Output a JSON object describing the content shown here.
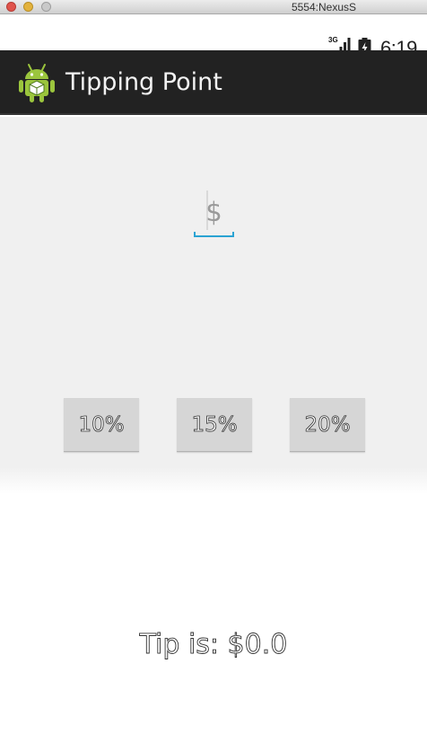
{
  "window": {
    "title": "5554:NexusS"
  },
  "status_bar": {
    "network": "3G",
    "signal_icon": "cell-signal-icon",
    "battery_icon": "battery-charging-icon",
    "time": "6:19"
  },
  "action_bar": {
    "app_icon": "android-robot-icon",
    "title": "Tipping Point"
  },
  "amount_input": {
    "placeholder": "$",
    "value": ""
  },
  "tip_buttons": [
    {
      "label": "10%"
    },
    {
      "label": "15%"
    },
    {
      "label": "20%"
    }
  ],
  "result": {
    "text": "Tip is: $0.0"
  },
  "colors": {
    "action_bar": "#222222",
    "content_bg": "#f0f0f0",
    "input_accent": "#2aa3d3",
    "button_bg": "#d6d6d6"
  }
}
